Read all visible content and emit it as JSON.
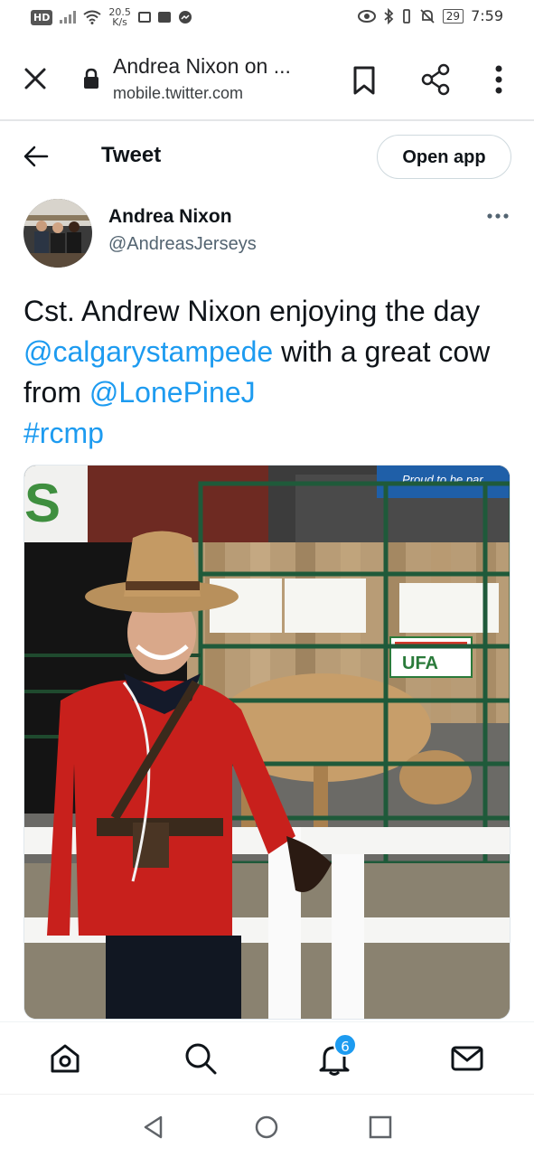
{
  "status_bar": {
    "network_badge": "HD",
    "speed_value": "20.5",
    "speed_unit": "K/s",
    "battery": "29",
    "time": "7:59"
  },
  "browser": {
    "page_title": "Andrea Nixon on ...",
    "url": "mobile.twitter.com"
  },
  "header": {
    "title": "Tweet",
    "open_app_label": "Open app"
  },
  "tweet": {
    "author_name": "Andrea Nixon",
    "author_handle": "@AndreasJerseys",
    "text_part1": "Cst. Andrew Nixon enjoying the day ",
    "mention1": "@calgarystampede",
    "text_part2": " with a great cow from ",
    "mention2": "@LonePineJ",
    "hashtag": "#rcmp"
  },
  "photo": {
    "banner_text": "Proud to be par",
    "sign_text": "UFA",
    "left_sign_text": "S"
  },
  "bottom_nav": {
    "notifications_badge": "6",
    "accent": "#1d9bf0"
  }
}
